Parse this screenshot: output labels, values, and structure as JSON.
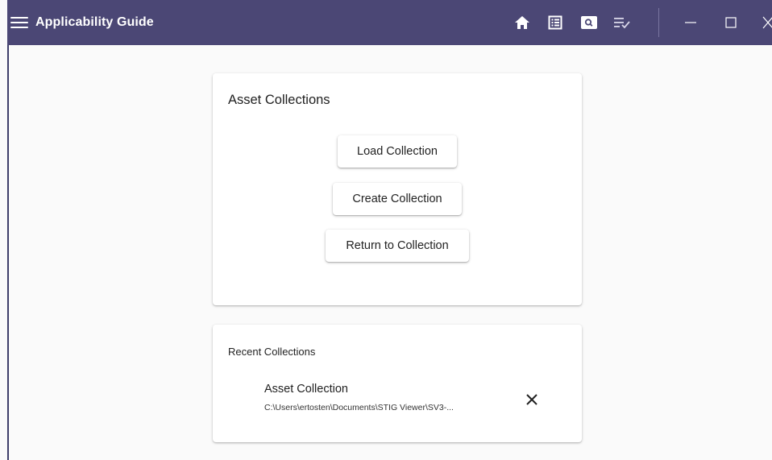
{
  "appbar": {
    "title": "Applicability Guide",
    "background": "#4b4775",
    "icons": [
      "menu-icon",
      "home-icon",
      "list-icon",
      "search-box-icon",
      "checklist-icon"
    ],
    "window_controls": [
      "minimize-icon",
      "maximize-icon",
      "close-icon"
    ]
  },
  "asset_collections": {
    "title": "Asset Collections",
    "load_label": "Load Collection",
    "create_label": "Create Collection",
    "return_label": "Return to Collection"
  },
  "recent": {
    "title": "Recent Collections",
    "items": [
      {
        "name": "Asset Collection",
        "path": "C:\\Users\\ertosten\\Documents\\STIG Viewer\\SV3-..."
      }
    ]
  }
}
